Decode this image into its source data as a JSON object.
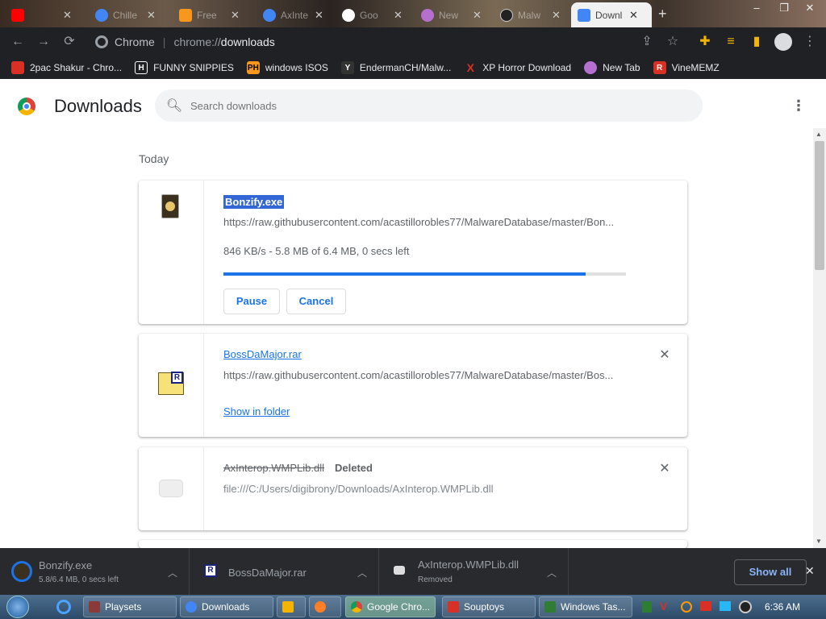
{
  "tabs": [
    {
      "title": "",
      "favicon_color": "#ff0000"
    },
    {
      "title": "Chille",
      "favicon_color": "#4285f4"
    },
    {
      "title": "Free",
      "favicon_color": "#f7971d"
    },
    {
      "title": "AxInte",
      "favicon_color": "#4285f4"
    },
    {
      "title": "Goo",
      "favicon_color": "#ffffff"
    },
    {
      "title": "New",
      "favicon_color": "#b56fcf"
    },
    {
      "title": "Malw",
      "favicon_color": "#222222"
    },
    {
      "title": "Downl",
      "favicon_color": "#4285f4",
      "active": true
    }
  ],
  "new_tab_glyph": "+",
  "toolbar": {
    "omnibox_label": "Chrome",
    "url_scheme": "chrome://",
    "url_host": "downloads"
  },
  "bookmarks": [
    {
      "label": "2pac Shakur - Chro...",
      "icon_text": "",
      "color": "#d93025"
    },
    {
      "label": "FUNNY SNIPPIES",
      "icon_text": "H",
      "color": "#202124"
    },
    {
      "label": "windows ISOS",
      "icon_text": "PH",
      "color": "#f7971d"
    },
    {
      "label": "EndermanCH/Malw...",
      "icon_text": "Y",
      "color": "#333333"
    },
    {
      "label": "XP Horror Download",
      "icon_text": "X",
      "color": "#202124"
    },
    {
      "label": "New Tab",
      "icon_text": "",
      "color": "#b56fcf"
    },
    {
      "label": "VineMEMZ",
      "icon_text": "R",
      "color": "#d93025"
    }
  ],
  "page": {
    "title": "Downloads",
    "search_placeholder": "Search downloads",
    "section_label": "Today"
  },
  "downloads": [
    {
      "filename": "Bonzify.exe",
      "url": "https://raw.githubusercontent.com/acastillorobles77/MalwareDatabase/master/Bon...",
      "status": "846 KB/s - 5.8 MB of 6.4 MB, 0 secs left",
      "progress": 0.9,
      "pause_label": "Pause",
      "cancel_label": "Cancel"
    },
    {
      "filename": "BossDaMajor.rar",
      "url": "https://raw.githubusercontent.com/acastillorobles77/MalwareDatabase/master/Bos...",
      "action_label": "Show in folder"
    },
    {
      "filename": "AxInterop.WMPLib.dll",
      "tag": "Deleted",
      "url": "file:///C:/Users/digibrony/Downloads/AxInterop.WMPLib.dll"
    }
  ],
  "shelf": {
    "items": [
      {
        "name": "Bonzify.exe",
        "status": "5.8/6.4 MB, 0 secs left"
      },
      {
        "name": "BossDaMajor.rar",
        "status": ""
      },
      {
        "name": "AxInterop.WMPLib.dll",
        "status": "Removed"
      }
    ],
    "show_all_label": "Show all"
  },
  "taskbar": {
    "items": [
      {
        "label": "Playsets",
        "color": "#8b3a3a"
      },
      {
        "label": "Downloads",
        "color": "#4285f4"
      },
      {
        "label": "",
        "color": "#f4b400"
      },
      {
        "label": "",
        "color": "#ff7f27"
      },
      {
        "label": "Google Chro...",
        "color": "#0f9d58"
      },
      {
        "label": "Souptoys",
        "color": "#d93025"
      },
      {
        "label": "Windows Tas...",
        "color": "#2e7d32"
      }
    ],
    "clock": "6:36 AM"
  }
}
